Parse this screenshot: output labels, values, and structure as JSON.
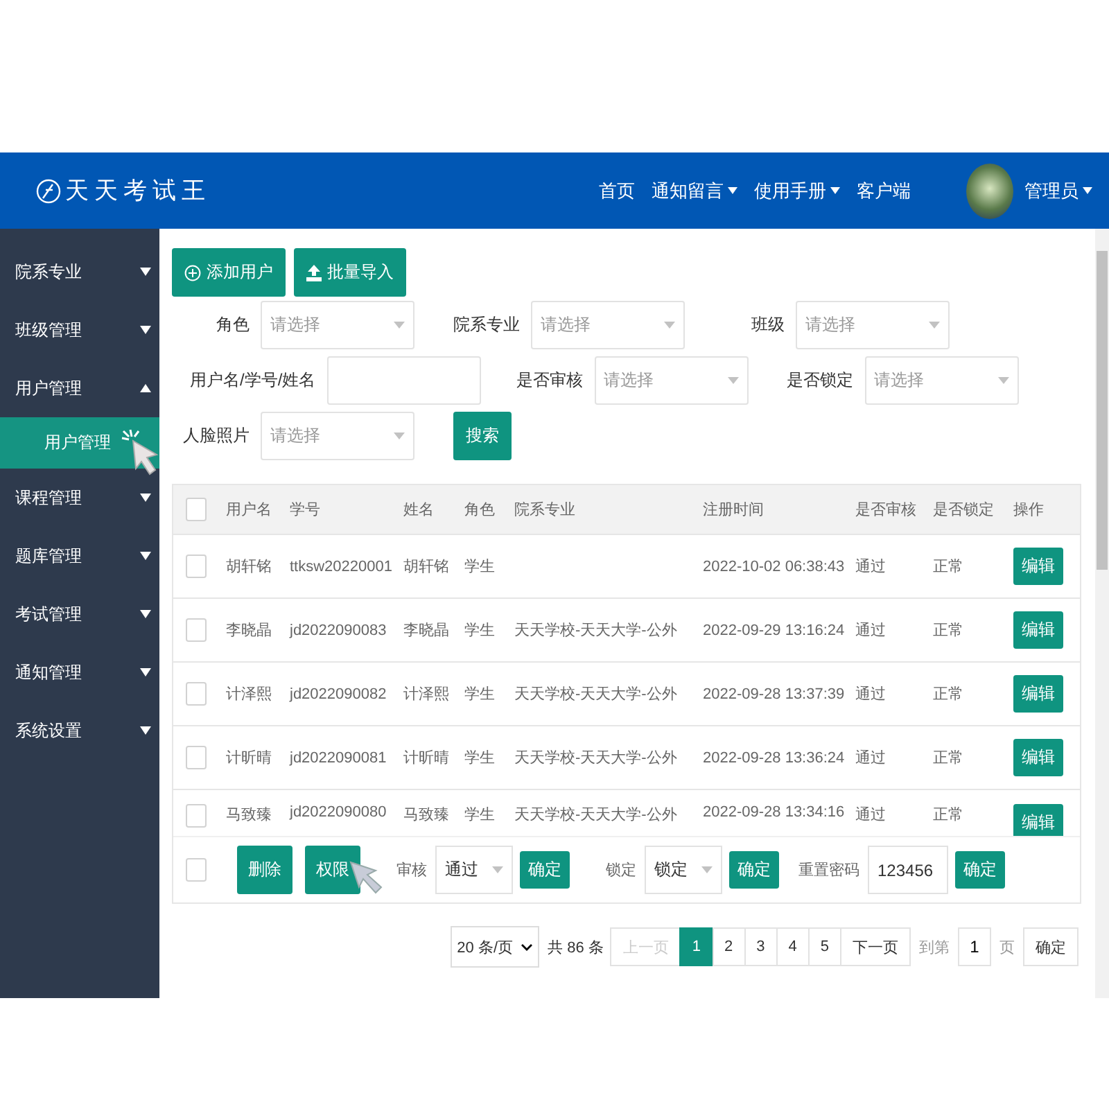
{
  "header": {
    "logo": "天天考试王",
    "nav": [
      {
        "label": "首页",
        "dropdown": false
      },
      {
        "label": "通知留言",
        "dropdown": true
      },
      {
        "label": "使用手册",
        "dropdown": true
      },
      {
        "label": "客户端",
        "dropdown": false
      }
    ],
    "user": {
      "name": "管理员",
      "dropdown": true
    }
  },
  "sidebar": {
    "items": [
      {
        "label": "院系专业",
        "expanded": false
      },
      {
        "label": "班级管理",
        "expanded": false
      },
      {
        "label": "用户管理",
        "expanded": true,
        "children": [
          {
            "label": "用户管理",
            "selected": true
          }
        ]
      },
      {
        "label": "课程管理",
        "expanded": false
      },
      {
        "label": "题库管理",
        "expanded": false
      },
      {
        "label": "考试管理",
        "expanded": false
      },
      {
        "label": "通知管理",
        "expanded": false
      },
      {
        "label": "系统设置",
        "expanded": false
      }
    ]
  },
  "toolbar": [
    {
      "label": "添加用户",
      "kind": "add"
    },
    {
      "label": "批量导入",
      "kind": "upload"
    }
  ],
  "filters": [
    [
      {
        "label": "角色",
        "kind": "select",
        "placeholder": "请选择"
      },
      {
        "label": "院系专业",
        "kind": "select",
        "placeholder": "请选择"
      },
      {
        "label": "班级",
        "kind": "select",
        "placeholder": "请选择"
      }
    ],
    [
      {
        "label": "用户名/学号/姓名",
        "kind": "text"
      },
      {
        "label": "是否审核",
        "kind": "select",
        "placeholder": "请选择"
      },
      {
        "label": "是否锁定",
        "kind": "select",
        "placeholder": "请选择"
      }
    ],
    [
      {
        "label": "人脸照片",
        "kind": "select",
        "placeholder": "请选择"
      }
    ]
  ],
  "search_button": "搜索",
  "table": {
    "header_checked": false,
    "columns": [
      "用户名",
      "学号",
      "姓名",
      "角色",
      "院系专业",
      "注册时间",
      "是否审核",
      "是否锁定",
      "操作"
    ],
    "rows": [
      {
        "checked": false,
        "cells": [
          "胡轩铭",
          "ttksw20220001",
          "胡轩铭",
          "学生",
          "",
          "2022-10-02 06:38:43",
          "通过",
          "正常"
        ],
        "action": "编辑"
      },
      {
        "checked": false,
        "cells": [
          "李晓晶",
          "jd2022090083",
          "李晓晶",
          "学生",
          "天天学校-天天大学-公外",
          "2022-09-29 13:16:24",
          "通过",
          "正常"
        ],
        "action": "编辑"
      },
      {
        "checked": false,
        "cells": [
          "计泽熙",
          "jd2022090082",
          "计泽熙",
          "学生",
          "天天学校-天天大学-公外",
          "2022-09-28 13:37:39",
          "通过",
          "正常"
        ],
        "action": "编辑"
      },
      {
        "checked": false,
        "cells": [
          "计昕晴",
          "jd2022090081",
          "计昕晴",
          "学生",
          "天天学校-天天大学-公外",
          "2022-09-28 13:36:24",
          "通过",
          "正常"
        ],
        "action": "编辑"
      },
      {
        "checked": false,
        "cells": [
          "马致臻",
          "jd2022090080",
          "马致臻",
          "学生",
          "天天学校-天天大学-公外",
          "2022-09-28 13:34:16",
          "通过",
          "正常"
        ],
        "action": "编辑"
      }
    ]
  },
  "batch": {
    "checked": false,
    "delete": "删除",
    "permission": "权限",
    "audit_label": "审核",
    "audit_value": "通过",
    "lock_label": "锁定",
    "lock_value": "锁定",
    "password_label": "重置密码",
    "password_value": "123456",
    "confirm": [
      "确定",
      "确定",
      "确定"
    ]
  },
  "pagination": {
    "page_size": "20 条/页",
    "total": "共 86 条",
    "prev": {
      "label": "上一页",
      "disabled": true
    },
    "pages": [
      {
        "label": "1",
        "selected": true
      },
      {
        "label": "2",
        "selected": false
      },
      {
        "label": "3",
        "selected": false
      },
      {
        "label": "4",
        "selected": false
      },
      {
        "label": "5",
        "selected": false
      }
    ],
    "next": {
      "label": "下一页",
      "disabled": false
    },
    "goto_label": "到第",
    "goto_value": "1",
    "page_unit": "页",
    "confirm": "确定"
  }
}
